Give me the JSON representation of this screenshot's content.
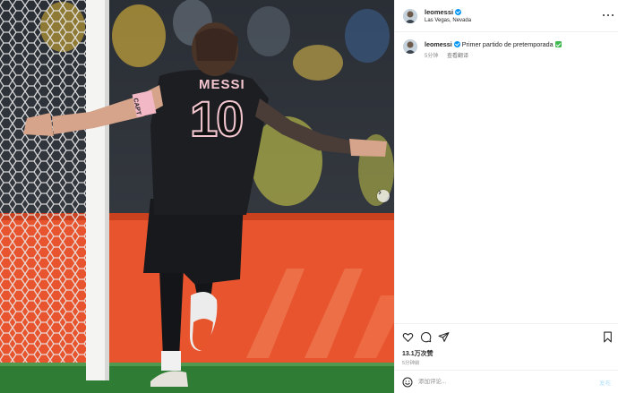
{
  "post": {
    "username": "leomessi",
    "location": "Las Vegas, Nevada",
    "caption": {
      "text": "Primer partido de pretemporada",
      "time": "5分钟",
      "see_translation": "查看翻译"
    },
    "photo": {
      "jersey_name": "MESSI",
      "jersey_number": "10",
      "armband": "CAPT"
    },
    "likes": "13.1万次赞",
    "posted_ago": "5分钟前",
    "comment": {
      "placeholder": "添加评论...",
      "post_label": "发布"
    }
  },
  "colors": {
    "verified": "#0095f6",
    "check_emoji": "#3fb950",
    "post_button": "#b2dffc"
  },
  "icons": [
    "more-icon",
    "heart-icon",
    "comment-icon",
    "share-icon",
    "bookmark-icon",
    "emoji-icon",
    "chevron-right-icon"
  ]
}
